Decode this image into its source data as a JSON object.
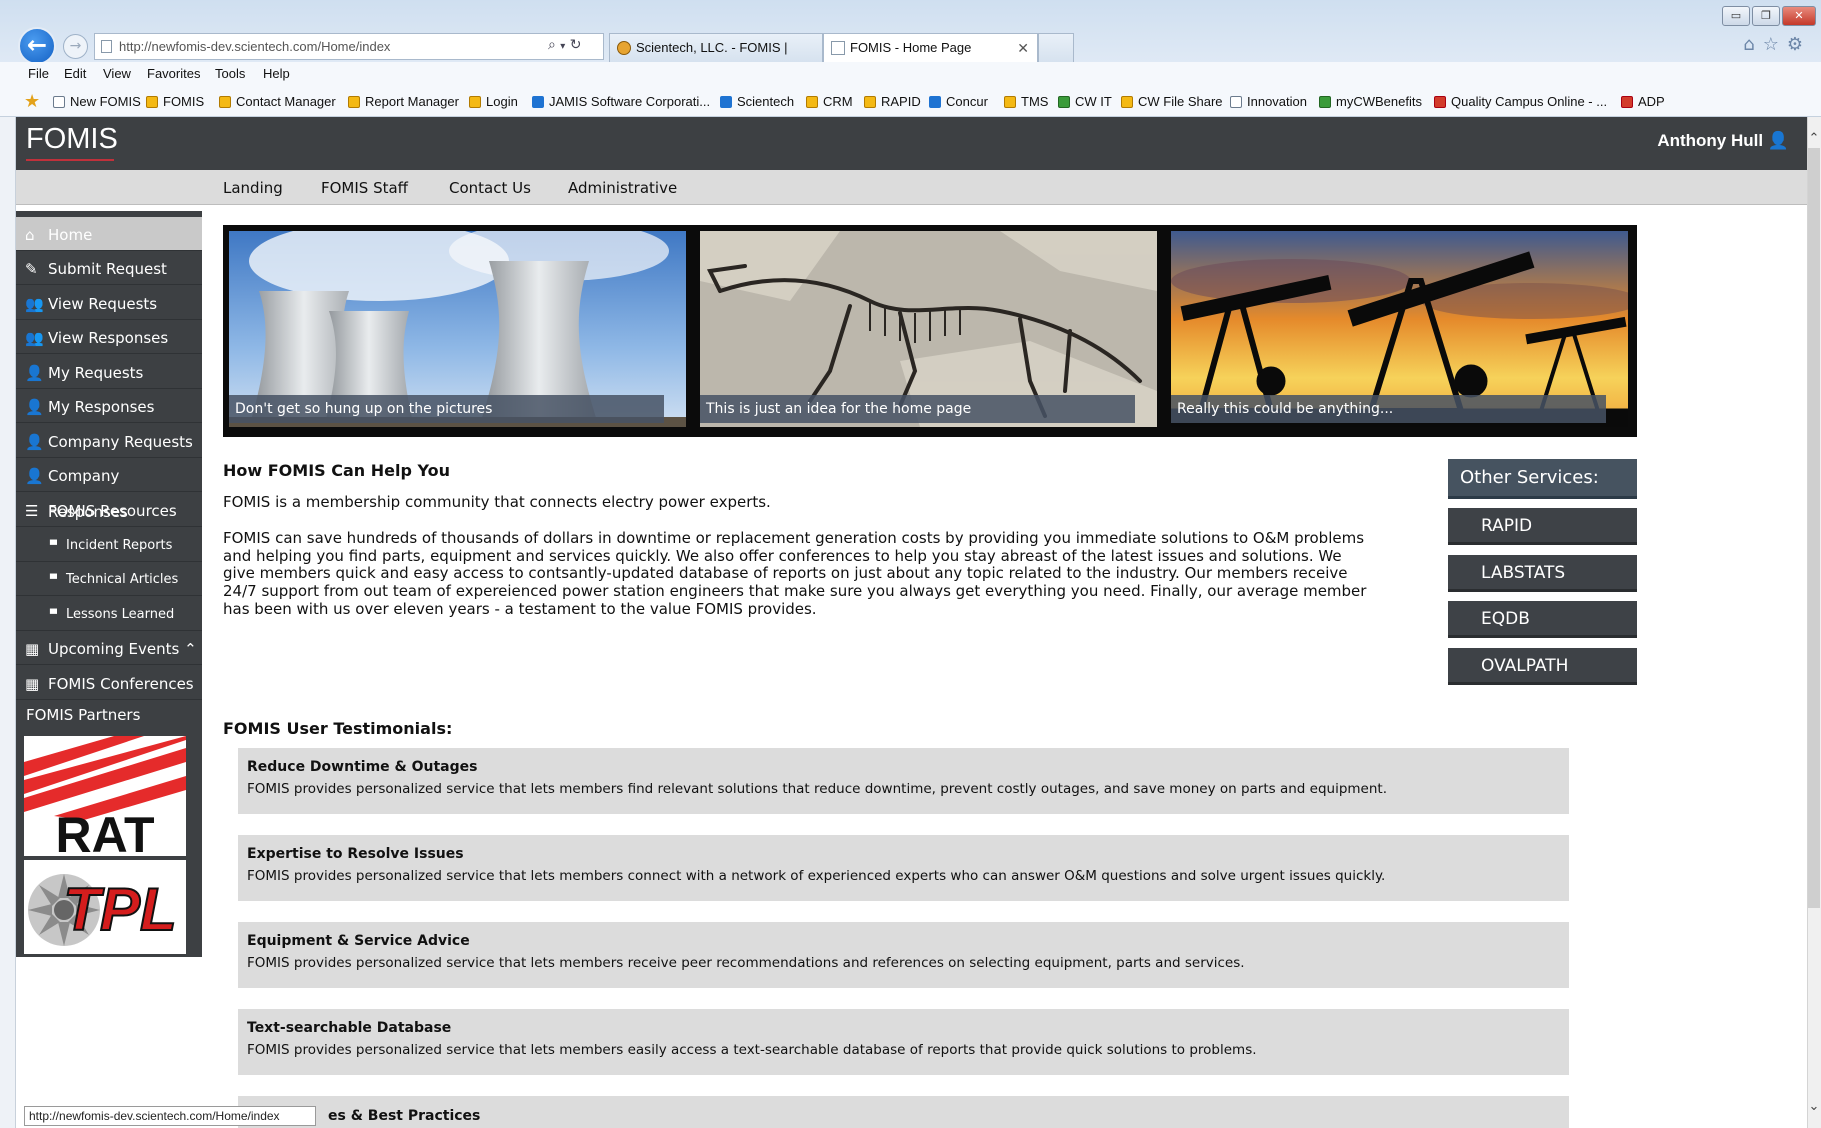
{
  "browser": {
    "url": "http://newfomis-dev.scientech.com/Home/index",
    "tabs": [
      {
        "label": "Scientech, LLC. - FOMIS | Home"
      },
      {
        "label": "FOMIS - Home Page"
      }
    ],
    "menu": [
      "File",
      "Edit",
      "View",
      "Favorites",
      "Tools",
      "Help"
    ],
    "favorites": [
      "New FOMIS",
      "FOMIS",
      "Contact Manager",
      "Report Manager",
      "Login",
      "JAMIS Software Corporati...",
      "Scientech",
      "CRM",
      "RAPID",
      "Concur",
      "TMS",
      "CW IT",
      "CW File Share",
      "Innovation",
      "myCWBenefits",
      "Quality Campus Online - ...",
      "ADP"
    ],
    "status_url": "http://newfomis-dev.scientech.com/Home/index"
  },
  "site": {
    "logo": "FOMIS",
    "user": "Anthony Hull",
    "topnav": [
      "Landing",
      "FOMIS Staff",
      "Contact Us",
      "Administrative"
    ]
  },
  "sidebar": {
    "items": [
      {
        "label": "Home",
        "icon": "home-icon"
      },
      {
        "label": "Submit Request",
        "icon": "pencil-icon"
      },
      {
        "label": "View Requests",
        "icon": "users-icon"
      },
      {
        "label": "View Responses",
        "icon": "users-icon"
      },
      {
        "label": "My Requests",
        "icon": "user-icon"
      },
      {
        "label": "My Responses",
        "icon": "user-icon"
      },
      {
        "label": "Company Requests",
        "icon": "user-icon"
      },
      {
        "label": "Company Responses",
        "icon": "user-icon"
      },
      {
        "label": "FOMIS Resources",
        "icon": "list-icon"
      },
      {
        "label": "Incident Reports",
        "icon": "bullet-icon"
      },
      {
        "label": "Technical Articles",
        "icon": "bullet-icon"
      },
      {
        "label": "Lessons Learned",
        "icon": "bullet-icon"
      },
      {
        "label": "Upcoming Events",
        "icon": "calendar-icon"
      },
      {
        "label": "FOMIS Conferences",
        "icon": "calendar-icon"
      }
    ],
    "partners_label": "FOMIS Partners",
    "partners": [
      "RAT",
      "TPL"
    ]
  },
  "carousel": {
    "captions": [
      "Don't get so hung up on the pictures",
      "This is just an idea for the home page",
      "Really this could be anything..."
    ]
  },
  "intro": {
    "heading": "How FOMIS Can Help You",
    "p1": "FOMIS is a membership community that connects electry power experts.",
    "p2_lines": [
      "FOMIS can save hundreds of thousands of dollars in downtime or replacement generation costs by providing you immediate solutions to O&M problems",
      "and helping you find parts, equipment and services quickly. We also offer conferences to help you stay abreast of the latest issues and solutions. We",
      "give members quick and easy access to contsantly-updated database of reports on just about any topic related to the industry. Our members receive",
      "24/7 support from out team of expereienced power station engineers that make sure you always get everything you need. Finally, our average member",
      "has been with us over eleven years - a testament to the value FOMIS provides."
    ]
  },
  "services": {
    "heading": "Other Services:",
    "items": [
      "RAPID",
      "LABSTATS",
      "EQDB",
      "OVALPATH"
    ]
  },
  "testimonials": {
    "heading": "FOMIS User Testimonials:",
    "items": [
      {
        "title": "Reduce Downtime & Outages",
        "text": "FOMIS provides personalized service that lets members find relevant solutions that reduce downtime, prevent costly outages, and save money on parts and equipment."
      },
      {
        "title": "Expertise to Resolve Issues",
        "text": "FOMIS provides personalized service that lets members connect with a network of experienced experts who can answer O&M questions and solve urgent issues quickly."
      },
      {
        "title": "Equipment & Service Advice",
        "text": "FOMIS provides personalized service that lets members receive peer recommendations and references on selecting equipment, parts and services."
      },
      {
        "title": "Text-searchable Database",
        "text": "FOMIS provides personalized service that lets members easily access a text-searchable database of reports that provide quick solutions to problems."
      },
      {
        "title": "es & Best Practices",
        "text": ""
      }
    ]
  },
  "colors": {
    "header": "#3d4043",
    "accent": "#c0313b",
    "nav": "#dcdcdc"
  }
}
